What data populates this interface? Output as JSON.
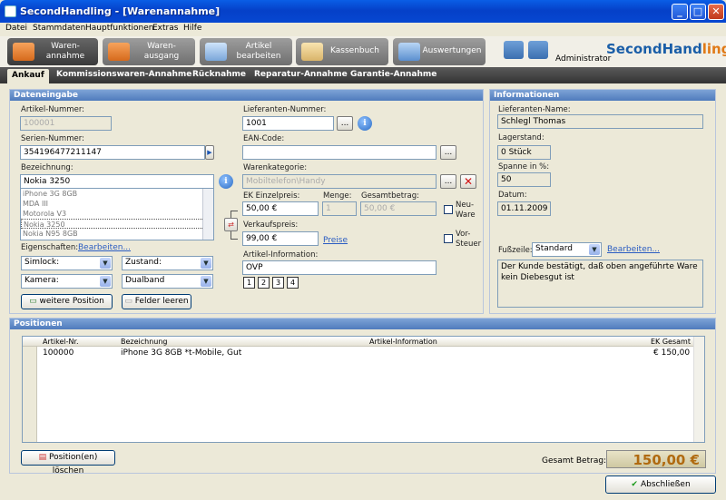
{
  "window": {
    "title": "SecondHandling - [Warenannahme]"
  },
  "menu": [
    "Datei",
    "Stammdaten",
    "Hauptfunktionen",
    "Extras",
    "Hilfe"
  ],
  "toolbar": {
    "buttons": [
      {
        "label": "Waren-\nannahme"
      },
      {
        "label": "Waren-\nausgang"
      },
      {
        "label": "Artikel\nbearbeiten"
      },
      {
        "label": "Kassenbuch"
      },
      {
        "label": "Auswertungen"
      }
    ],
    "user": "Administrator",
    "logo_main": "SecondHand",
    "logo_accent": "ling"
  },
  "subtabs": [
    "Ankauf",
    "Kommissionswaren-Annahme",
    "Rücknahme",
    "Reparatur-Annahme",
    "Garantie-Annahme"
  ],
  "dateneingabe": {
    "header": "Dateneingabe",
    "artikel_nr_label": "Artikel-Nummer:",
    "artikel_nr": "100001",
    "serien_nr_label": "Serien-Nummer:",
    "serien_nr": "354196477211147",
    "bezeichnung_label": "Bezeichnung:",
    "bezeichnung": "Nokia 3250",
    "suggestions": [
      "iPhone 3G 8GB",
      "MDA III",
      "Motorola V3",
      "Nokia 3250",
      "Nokia N95 8GB"
    ],
    "eigenschaften_label": "Eigenschaften:",
    "eigenschaften_link": "Bearbeiten...",
    "props": [
      "Simlock:",
      "Zustand:",
      "Kamera:",
      "Dualband"
    ],
    "btn_weitere": "weitere Position",
    "btn_leeren": "Felder leeren",
    "lieferanten_nr_label": "Lieferanten-Nummer:",
    "lieferanten_nr": "1001",
    "ean_label": "EAN-Code:",
    "ean": "",
    "warenkategorie_label": "Warenkategorie:",
    "warenkategorie": "Mobiltelefon\\Handy",
    "ek_label": "EK Einzelpreis:",
    "ek": "50,00 €",
    "menge_label": "Menge:",
    "menge": "1",
    "gesamt_label": "Gesamtbetrag:",
    "gesamt": "50,00 €",
    "neuware": "Neu-\nWare",
    "vorsteuer": "Vor-\nSteuer",
    "vk_label": "Verkaufspreis:",
    "vk": "99,00 €",
    "preise_link": "Preise",
    "info_label": "Artikel-Information:",
    "info": "OVP",
    "pages": [
      "1",
      "2",
      "3",
      "4"
    ]
  },
  "informationen": {
    "header": "Informationen",
    "name_label": "Lieferanten-Name:",
    "name": "Schlegl  Thomas",
    "lager_label": "Lagerstand:",
    "lager": "0 Stück",
    "spanne_label": "Spanne in %:",
    "spanne": "50",
    "datum_label": "Datum:",
    "datum": "01.11.2009",
    "fusszeile_label": "Fußzeile:",
    "fusszeile": "Standard",
    "fusszeile_link": "Bearbeiten...",
    "footer_text": "Der Kunde bestätigt, daß oben angeführte Ware kein Diebesgut ist"
  },
  "positionen": {
    "header": "Positionen",
    "columns": [
      "Artikel-Nr.",
      "Bezeichnung",
      "Artikel-Information",
      "EK Gesamt"
    ],
    "rows": [
      {
        "nr": "100000",
        "bez": "iPhone 3G 8GB *t-Mobile, Gut",
        "info": "",
        "ek": "€ 150,00"
      }
    ],
    "btn_loeschen": "Position(en) löschen",
    "total_label": "Gesamt Betrag:",
    "total": "150,00 €"
  },
  "footer": {
    "btn_close": "Abschließen"
  }
}
